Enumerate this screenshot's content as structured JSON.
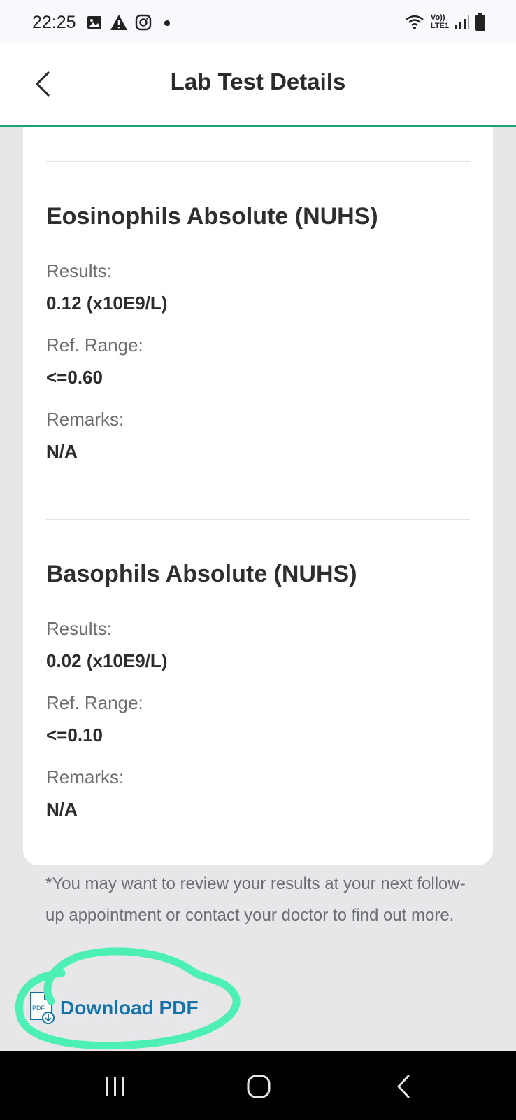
{
  "status_bar": {
    "time": "22:25",
    "left_icons": [
      "image-icon",
      "warning-icon",
      "instagram-icon",
      "dot-icon"
    ],
    "right_icons": [
      "wifi-icon",
      "volte-icon",
      "signal-icon",
      "battery-icon"
    ],
    "volte_top": "Vo))",
    "volte_bottom": "LTE1"
  },
  "header": {
    "title": "Lab Test Details"
  },
  "tests": [
    {
      "name": "Eosinophils Absolute (NUHS)",
      "results_label": "Results:",
      "results_value": "0.12 (x10E9/L)",
      "range_label": "Ref. Range:",
      "range_value": "<=0.60",
      "remarks_label": "Remarks:",
      "remarks_value": "N/A"
    },
    {
      "name": "Basophils Absolute (NUHS)",
      "results_label": "Results:",
      "results_value": "0.02 (x10E9/L)",
      "range_label": "Ref. Range:",
      "range_value": "<=0.10",
      "remarks_label": "Remarks:",
      "remarks_value": "N/A"
    }
  ],
  "footnote": "*You may want to review your results at your next follow-up appointment or contact your doctor to find out more.",
  "download": {
    "label": "Download PDF",
    "icon_text": "PDF"
  },
  "colors": {
    "accent": "#1aa37a",
    "link": "#1373a8",
    "highlight": "#4df0b4"
  }
}
